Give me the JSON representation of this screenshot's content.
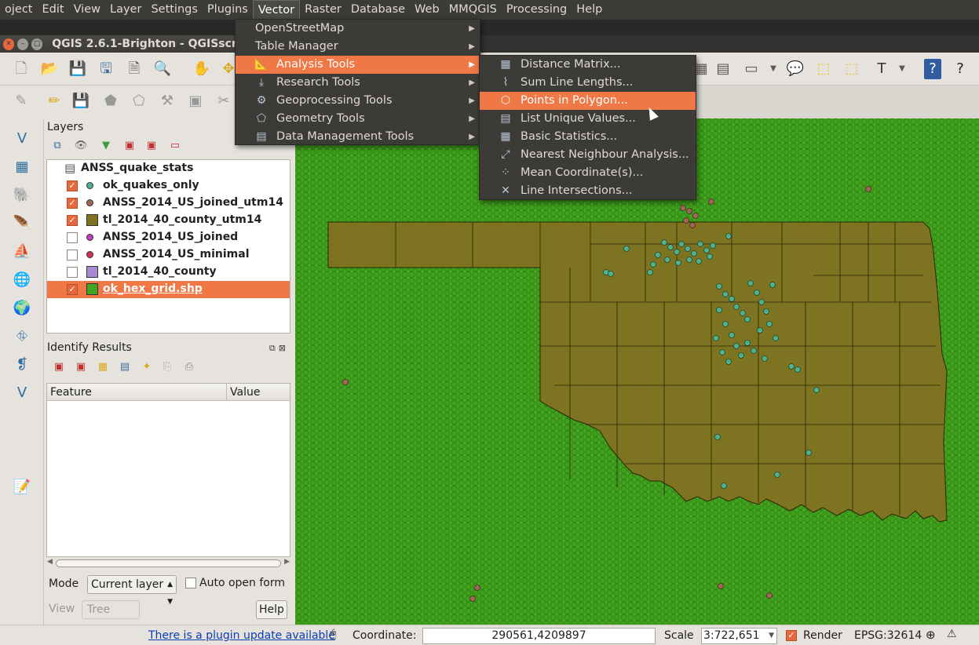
{
  "menubar": {
    "items": [
      "oject",
      "Edit",
      "View",
      "Layer",
      "Settings",
      "Plugins",
      "Vector",
      "Raster",
      "Database",
      "Web",
      "MMQGIS",
      "Processing",
      "Help"
    ],
    "active": "Vector"
  },
  "window": {
    "title": "QGIS 2.6.1-Brighton - QGISscratc"
  },
  "vector_menu": {
    "items": [
      {
        "label": "OpenStreetMap",
        "icon": "none",
        "submenu": true
      },
      {
        "label": "Table Manager",
        "icon": "none",
        "submenu": true
      },
      {
        "label": "Analysis Tools",
        "icon": "ruler-icon",
        "submenu": true,
        "highlighted": true
      },
      {
        "label": "Research Tools",
        "icon": "download-arrow-icon",
        "submenu": true
      },
      {
        "label": "Geoprocessing Tools",
        "icon": "gear-icon",
        "submenu": true
      },
      {
        "label": "Geometry Tools",
        "icon": "polygon-icon",
        "submenu": true
      },
      {
        "label": "Data Management Tools",
        "icon": "table-stack-icon",
        "submenu": true
      }
    ]
  },
  "analysis_menu": {
    "items": [
      {
        "label": "Distance Matrix...",
        "icon": "matrix-icon"
      },
      {
        "label": "Sum Line Lengths...",
        "icon": "line-length-icon"
      },
      {
        "label": "Points in Polygon...",
        "icon": "points-polygon-icon",
        "highlighted": true
      },
      {
        "label": "List Unique Values...",
        "icon": "unique-values-icon"
      },
      {
        "label": "Basic Statistics...",
        "icon": "statistics-grid-icon"
      },
      {
        "label": "Nearest Neighbour Analysis...",
        "icon": "nearest-neighbour-icon"
      },
      {
        "label": "Mean Coordinate(s)...",
        "icon": "mean-coordinate-icon"
      },
      {
        "label": "Line Intersections...",
        "icon": "line-intersection-icon"
      }
    ]
  },
  "layers_panel": {
    "title": "Layers",
    "layers": [
      {
        "name": "ANSS_quake_stats",
        "checkbox": false,
        "symbol": "table",
        "color": "#555555"
      },
      {
        "name": "ok_quakes_only",
        "checkbox": true,
        "checked": true,
        "symbol": "dot",
        "color": "#4fb08a"
      },
      {
        "name": "ANSS_2014_US_joined_utm14",
        "checkbox": true,
        "checked": true,
        "symbol": "dot",
        "color": "#a0665a"
      },
      {
        "name": "tl_2014_40_county_utm14",
        "checkbox": true,
        "checked": true,
        "symbol": "square",
        "color": "#7e7320"
      },
      {
        "name": "ANSS_2014_US_joined",
        "checkbox": true,
        "checked": false,
        "symbol": "dot",
        "color": "#c23ac2"
      },
      {
        "name": "ANSS_2014_US_minimal",
        "checkbox": true,
        "checked": false,
        "symbol": "dot",
        "color": "#d83050"
      },
      {
        "name": "tl_2014_40_county",
        "checkbox": true,
        "checked": false,
        "symbol": "square",
        "color": "#a98ad0"
      },
      {
        "name": "ok_hex_grid.shp",
        "checkbox": true,
        "checked": true,
        "symbol": "square",
        "color": "#44a421",
        "selected": true
      }
    ]
  },
  "identify_panel": {
    "title": "Identify Results",
    "columns": [
      "Feature",
      "Value"
    ],
    "mode_label": "Mode",
    "mode_value": "Current layer",
    "auto_open_label": "Auto open form",
    "view_label": "View",
    "view_value": "Tree",
    "help_label": "Help"
  },
  "statusbar": {
    "plugin_update": "There is a plugin update available",
    "coordinate_label": "Coordinate:",
    "coordinate_value": "290561,4209897",
    "scale_label": "Scale",
    "scale_value": "3:722,651",
    "render_label": "Render",
    "epsg_label": "EPSG:32614"
  },
  "colors": {
    "menu_bg": "#3c3b37",
    "highlight": "#f07746",
    "hex_grid": "#44a421",
    "county_fill": "#7e7320",
    "quake_points": "#4fb08a"
  }
}
